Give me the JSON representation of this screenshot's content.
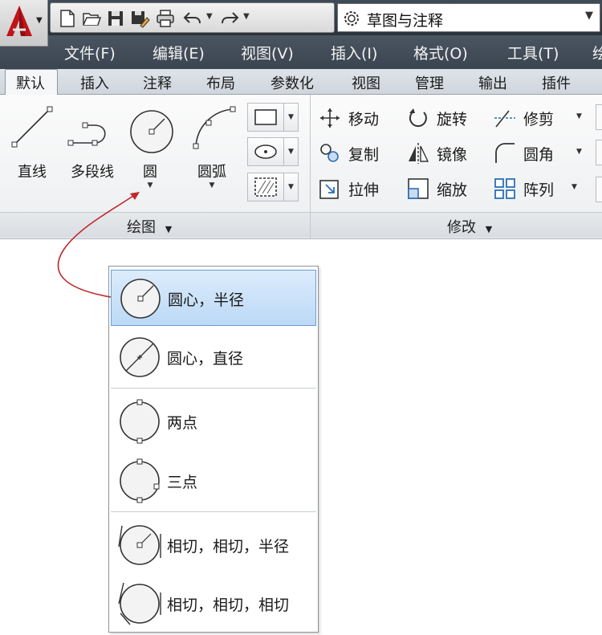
{
  "window": {
    "workspace": "草图与注释"
  },
  "menubar": {
    "items": [
      "文件(F)",
      "编辑(E)",
      "视图(V)",
      "插入(I)",
      "格式(O)",
      "工具(T)",
      "绘"
    ]
  },
  "tabs": [
    "默认",
    "插入",
    "注释",
    "布局",
    "参数化",
    "视图",
    "管理",
    "输出",
    "插件"
  ],
  "draw_panel": {
    "title": "绘图",
    "tools": {
      "line": "直线",
      "polyline": "多段线",
      "circle": "圆",
      "arc": "圆弧"
    }
  },
  "modify_panel": {
    "title": "修改",
    "tools": {
      "move": "移动",
      "rotate": "旋转",
      "trim": "修剪",
      "copy": "复制",
      "mirror": "镜像",
      "fillet": "圆角",
      "stretch": "拉伸",
      "scale": "缩放",
      "array": "阵列"
    }
  },
  "circle_flyout": {
    "items": [
      {
        "label": "圆心，半径"
      },
      {
        "label": "圆心，直径"
      },
      {
        "label": "两点"
      },
      {
        "label": "三点"
      },
      {
        "label": "相切，相切，半径"
      },
      {
        "label": "相切，相切，相切"
      }
    ]
  },
  "colors": {
    "selected_bg": "#bcd9f6",
    "callout_arrow": "#c0282d",
    "menubar": "#3b4550"
  }
}
